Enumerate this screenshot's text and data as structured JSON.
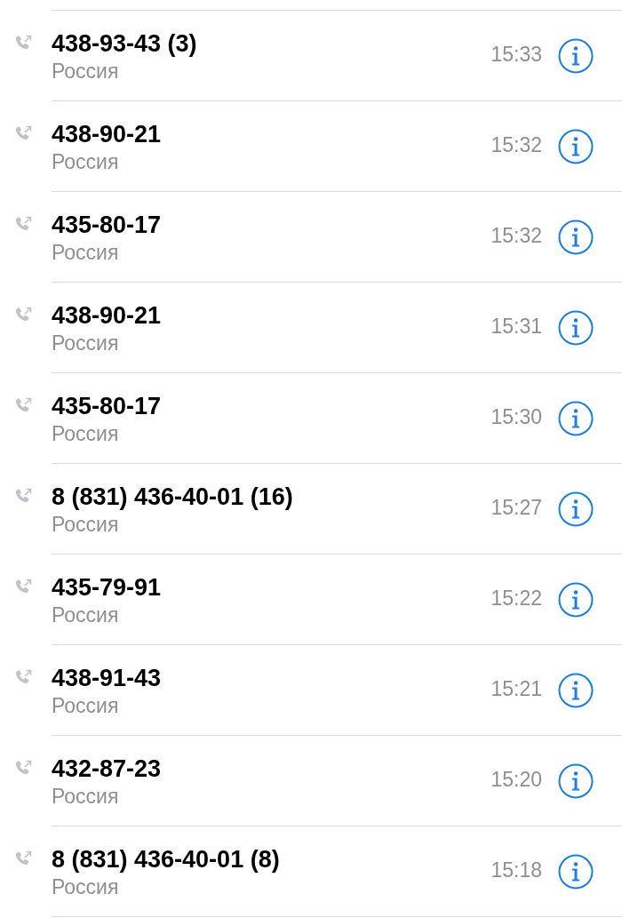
{
  "calls": [
    {
      "number": "438-93-43 (3)",
      "location": "Россия",
      "time": "15:33"
    },
    {
      "number": "438-90-21",
      "location": "Россия",
      "time": "15:32"
    },
    {
      "number": "435-80-17",
      "location": "Россия",
      "time": "15:32"
    },
    {
      "number": "438-90-21",
      "location": "Россия",
      "time": "15:31"
    },
    {
      "number": "435-80-17",
      "location": "Россия",
      "time": "15:30"
    },
    {
      "number": "8 (831) 436-40-01 (16)",
      "location": "Россия",
      "time": "15:27"
    },
    {
      "number": "435-79-91",
      "location": "Россия",
      "time": "15:22"
    },
    {
      "number": "438-91-43",
      "location": "Россия",
      "time": "15:21"
    },
    {
      "number": "432-87-23",
      "location": "Россия",
      "time": "15:20"
    },
    {
      "number": "8 (831) 436-40-01 (8)",
      "location": "Россия",
      "time": "15:18"
    }
  ]
}
